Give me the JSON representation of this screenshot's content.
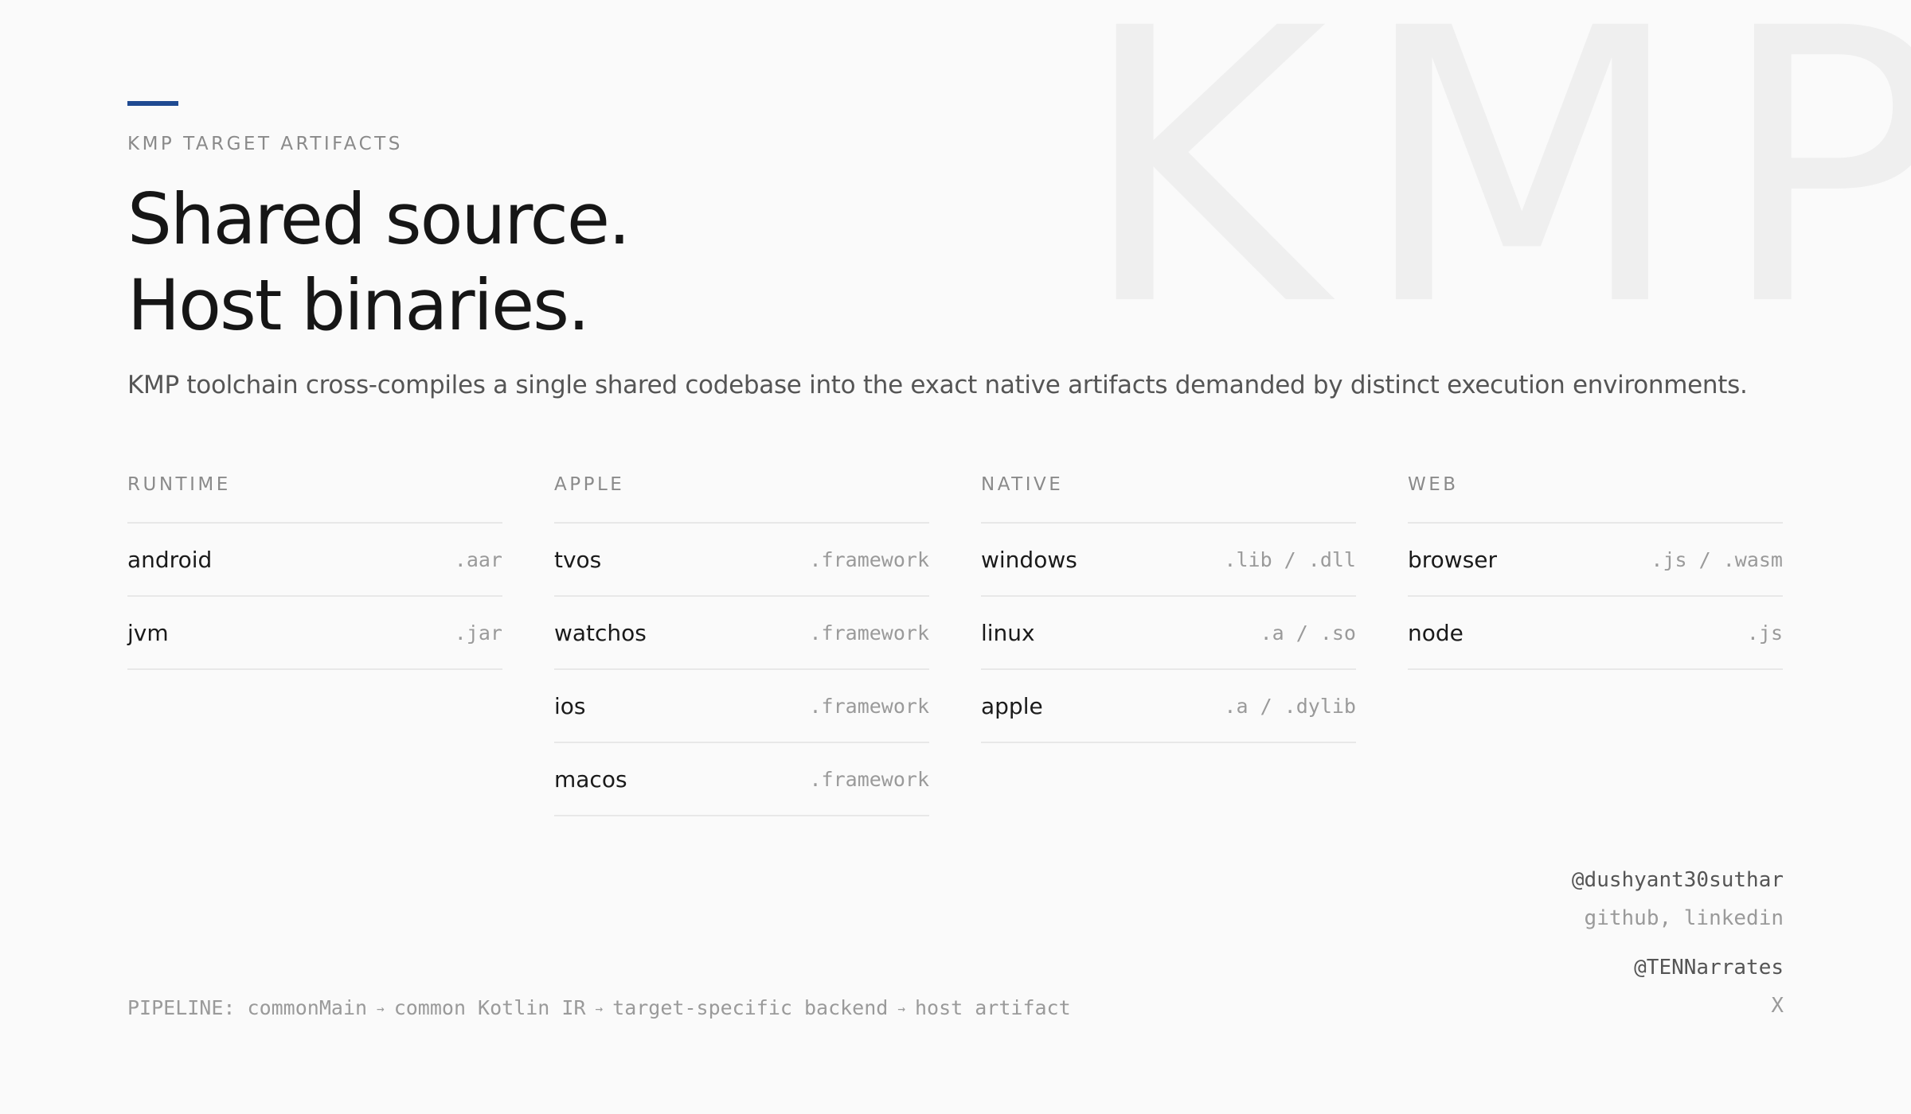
{
  "watermark": "KMP",
  "header": {
    "eyebrow": "KMP TARGET ARTIFACTS",
    "headline_line1": "Shared source.",
    "headline_line2": "Host binaries.",
    "lede": "KMP toolchain cross-compiles a single shared codebase into the exact native artifacts demanded by distinct execution environments."
  },
  "columns": [
    {
      "title": "RUNTIME",
      "rows": [
        {
          "name": "android",
          "ext": ".aar"
        },
        {
          "name": "jvm",
          "ext": ".jar"
        }
      ]
    },
    {
      "title": "APPLE",
      "rows": [
        {
          "name": "tvos",
          "ext": ".framework"
        },
        {
          "name": "watchos",
          "ext": ".framework"
        },
        {
          "name": "ios",
          "ext": ".framework"
        },
        {
          "name": "macos",
          "ext": ".framework"
        }
      ]
    },
    {
      "title": "NATIVE",
      "rows": [
        {
          "name": "windows",
          "ext": ".lib / .dll"
        },
        {
          "name": "linux",
          "ext": ".a / .so"
        },
        {
          "name": "apple",
          "ext": ".a / .dylib"
        }
      ]
    },
    {
      "title": "WEB",
      "rows": [
        {
          "name": "browser",
          "ext": ".js / .wasm"
        },
        {
          "name": "node",
          "ext": ".js"
        }
      ]
    }
  ],
  "credits": {
    "handle1": "@dushyant30suthar",
    "platforms1": "github, linkedin",
    "handle2": "@TENNarrates",
    "platforms2": "X"
  },
  "pipeline": {
    "label": "PIPELINE:",
    "steps": [
      "commonMain",
      "common Kotlin IR",
      "target-specific backend",
      "host artifact"
    ],
    "arrow": "→"
  },
  "colors": {
    "accent": "#1f4a91",
    "background": "#fafafa"
  }
}
